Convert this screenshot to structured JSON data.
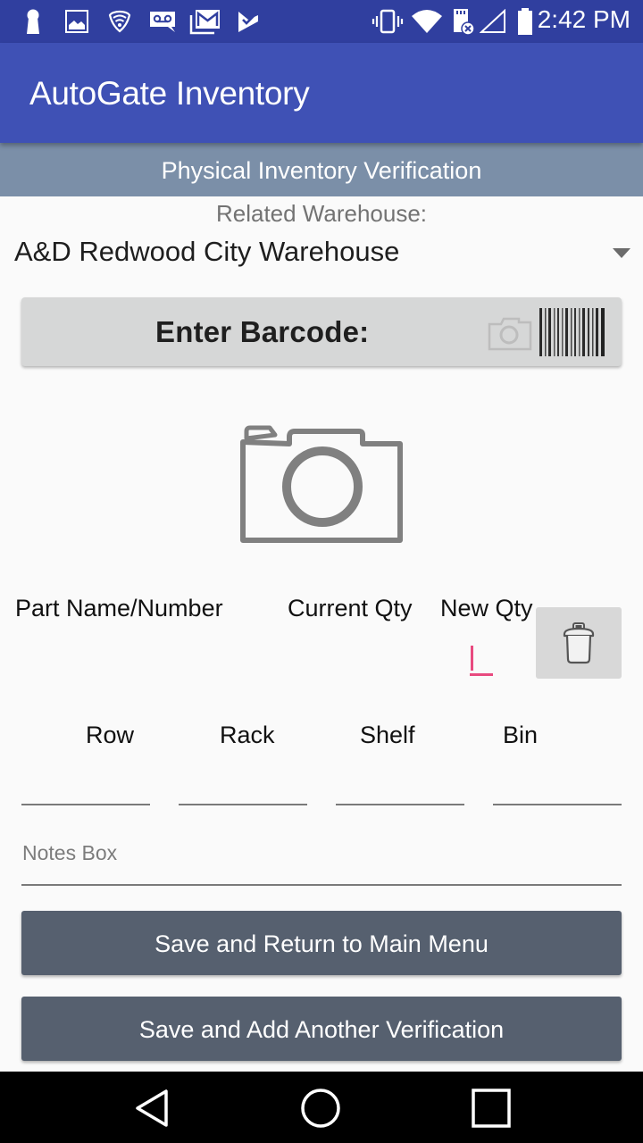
{
  "status_bar": {
    "time": "2:42 PM",
    "left_icons": [
      "keyhole-icon",
      "image-icon",
      "shield-wifi-icon",
      "voicemail-icon",
      "gmail-icon",
      "checkmark-app-icon"
    ],
    "right_icons": [
      "vibrate-icon",
      "wifi-icon",
      "sd-card-error-icon",
      "signal-icon",
      "battery-icon"
    ]
  },
  "app_bar": {
    "title": "AutoGate Inventory"
  },
  "sub_header": {
    "title": "Physical Inventory Verification"
  },
  "warehouse": {
    "label": "Related Warehouse:",
    "selected": "A&D Redwood City Warehouse"
  },
  "barcode": {
    "label": "Enter Barcode:",
    "icons": [
      "camera-icon",
      "barcode-icon"
    ]
  },
  "photo": {
    "icon": "camera-icon"
  },
  "columns": {
    "part": "Part Name/Number",
    "current_qty": "Current Qty",
    "new_qty": "New Qty",
    "new_qty_value": ""
  },
  "location": {
    "labels": [
      "Row",
      "Rack",
      "Shelf",
      "Bin"
    ],
    "values": [
      "",
      "",
      "",
      ""
    ]
  },
  "notes": {
    "placeholder": "Notes Box",
    "value": ""
  },
  "buttons": {
    "save_return": "Save and Return to Main Menu",
    "save_add": "Save and Add Another Verification"
  },
  "colors": {
    "status_bar": "#303f9f",
    "app_bar": "#3f51b5",
    "sub_header": "#7b8fa8",
    "action_button": "#56606f",
    "cursor_accent": "#e84a7f"
  }
}
